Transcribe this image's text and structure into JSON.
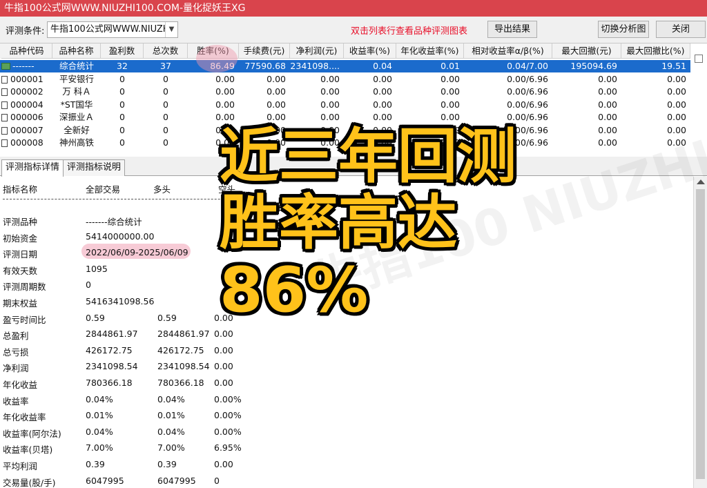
{
  "window": {
    "title": "牛指100公式网WWW.NIUZHI100.COM-量化捉妖王XG"
  },
  "toolbar": {
    "condition_label": "评测条件:",
    "condition_value": "牛指100公式网WWW.NIUZH",
    "hint": "双击列表行查看品种评测图表",
    "export_label": "导出结果",
    "switch_label": "切换分析图",
    "close_label": "关闭"
  },
  "grid": {
    "columns": [
      "品种代码",
      "品种名称",
      "盈利数",
      "总次数",
      "胜率(%)",
      "手续费(元)",
      "净利润(元)",
      "收益率(%)",
      "年化收益率(%)",
      "相对收益率α/β(%)",
      "最大回撤(元)",
      "最大回撤比(%)"
    ],
    "rows": [
      [
        "-------",
        "综合统计",
        "32",
        "37",
        "86.49",
        "77590.68",
        "2341098....",
        "0.04",
        "0.01",
        "0.04/7.00",
        "195094.69",
        "19.51"
      ],
      [
        "000001",
        "平安银行",
        "0",
        "0",
        "0.00",
        "0.00",
        "0.00",
        "0.00",
        "0.00",
        "0.00/6.96",
        "0.00",
        "0.00"
      ],
      [
        "000002",
        "万 科Ａ",
        "0",
        "0",
        "0.00",
        "0.00",
        "0.00",
        "0.00",
        "0.00",
        "0.00/6.96",
        "0.00",
        "0.00"
      ],
      [
        "000004",
        "*ST国华",
        "0",
        "0",
        "0.00",
        "0.00",
        "0.00",
        "0.00",
        "0.00",
        "0.00/6.96",
        "0.00",
        "0.00"
      ],
      [
        "000006",
        "深振业Ａ",
        "0",
        "0",
        "0.00",
        "0.00",
        "0.00",
        "0.00",
        "0.00",
        "0.00/6.96",
        "0.00",
        "0.00"
      ],
      [
        "000007",
        "全新好",
        "0",
        "0",
        "0.00",
        "0.00",
        "0.00",
        "0.00",
        "0.00",
        "0.00/6.96",
        "0.00",
        "0.00"
      ],
      [
        "000008",
        "神州高铁",
        "0",
        "0",
        "0.00",
        "0.00",
        "0.00",
        "0.00",
        "0.00",
        "0.00/6.96",
        "0.00",
        "0.00"
      ]
    ]
  },
  "tabs": [
    "评测指标详情",
    "评测指标说明"
  ],
  "detail": {
    "headers": [
      "指标名称",
      "全部交易",
      "多头",
      "空头"
    ],
    "rows": [
      [
        "评测品种",
        "-------综合统计",
        "",
        ""
      ],
      [
        "初始资金",
        "5414000000.00",
        "",
        ""
      ],
      [
        "评测日期",
        "2022/06/09-2025/06/09",
        "",
        ""
      ],
      [
        "有效天数",
        "1095",
        "",
        ""
      ],
      [
        "评测周期数",
        "0",
        "",
        ""
      ],
      [
        "期末权益",
        "5416341098.56",
        "",
        ""
      ],
      [
        "盈亏时间比",
        "0.59",
        "0.59",
        "0.00"
      ],
      [
        "总盈利",
        "2844861.97",
        "2844861.97",
        "0.00"
      ],
      [
        "总亏损",
        "426172.75",
        "426172.75",
        "0.00"
      ],
      [
        "净利润",
        "2341098.54",
        "2341098.54",
        "0.00"
      ],
      [
        "年化收益",
        "780366.18",
        "780366.18",
        "0.00"
      ],
      [
        "收益率",
        "0.04%",
        "0.04%",
        "0.00%"
      ],
      [
        "年化收益率",
        "0.01%",
        "0.01%",
        "0.00%"
      ],
      [
        "收益率(阿尔法)",
        "0.04%",
        "0.04%",
        "0.00%"
      ],
      [
        "收益率(贝塔)",
        "7.00%",
        "7.00%",
        "6.95%"
      ],
      [
        "平均利润",
        "0.39",
        "0.39",
        "0.00"
      ],
      [
        "交易量(股/手)",
        "6047995",
        "6047995",
        "0"
      ]
    ]
  },
  "overlay": {
    "line1": "近三年回测",
    "line2": "胜率高达",
    "line3": "86%"
  },
  "watermark": "牛指100 NIUZHI100.COM",
  "colors": {
    "titlebar": "#d9444c",
    "selection": "#1b6bcc",
    "hint": "#e8102a",
    "promo": "#ffc21a"
  }
}
